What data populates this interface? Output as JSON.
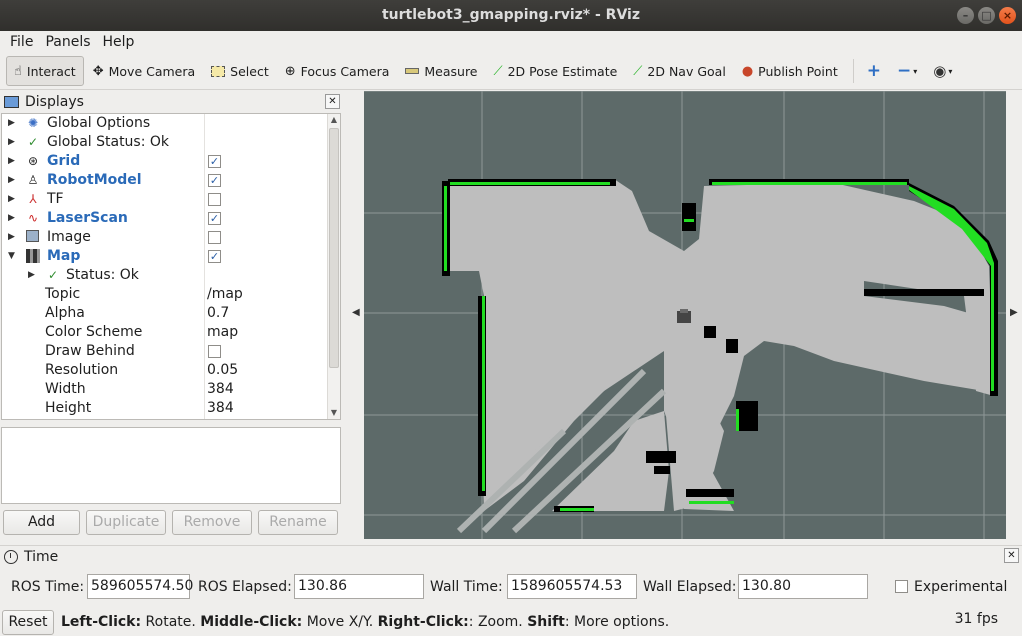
{
  "window": {
    "title": "turtlebot3_gmapping.rviz* - RViz"
  },
  "menu": {
    "file": "File",
    "panels": "Panels",
    "help": "Help"
  },
  "toolbar": {
    "interact": "Interact",
    "move_camera": "Move Camera",
    "select": "Select",
    "focus_camera": "Focus Camera",
    "measure": "Measure",
    "pose_estimate": "2D Pose Estimate",
    "nav_goal": "2D Nav Goal",
    "publish_point": "Publish Point"
  },
  "displays": {
    "title": "Displays",
    "items": [
      {
        "label": "Global Options",
        "icon": "gear-icon"
      },
      {
        "label": "Global Status: Ok",
        "icon": "check-icon"
      },
      {
        "label": "Grid",
        "icon": "grid-icon",
        "checked": true
      },
      {
        "label": "RobotModel",
        "icon": "robot-icon",
        "checked": true
      },
      {
        "label": "TF",
        "icon": "tf-icon",
        "checked": false
      },
      {
        "label": "LaserScan",
        "icon": "laser-icon",
        "checked": true
      },
      {
        "label": "Image",
        "icon": "image-icon",
        "checked": false
      },
      {
        "label": "Map",
        "icon": "map-icon",
        "checked": true
      }
    ],
    "map_props": [
      {
        "label": "Status: Ok"
      },
      {
        "label": "Topic",
        "value": "/map"
      },
      {
        "label": "Alpha",
        "value": "0.7"
      },
      {
        "label": "Color Scheme",
        "value": "map"
      },
      {
        "label": "Draw Behind",
        "checked": false
      },
      {
        "label": "Resolution",
        "value": "0.05"
      },
      {
        "label": "Width",
        "value": "384"
      },
      {
        "label": "Height",
        "value": "384"
      }
    ],
    "buttons": {
      "add": "Add",
      "duplicate": "Duplicate",
      "remove": "Remove",
      "rename": "Rename"
    }
  },
  "time": {
    "title": "Time",
    "ros_time_label": "ROS Time:",
    "ros_time": "589605574.50",
    "ros_elapsed_label": "ROS Elapsed:",
    "ros_elapsed": "130.86",
    "wall_time_label": "Wall Time:",
    "wall_time": "1589605574.53",
    "wall_elapsed_label": "Wall Elapsed:",
    "wall_elapsed": "130.80",
    "experimental": "Experimental"
  },
  "status": {
    "reset": "Reset",
    "left_click": "Left-Click:",
    "left_desc": " Rotate. ",
    "middle_click": "Middle-Click:",
    "middle_desc": " Move X/Y. ",
    "right_click": "Right-Click:",
    "right_desc": ": Zoom. ",
    "shift": "Shift",
    "shift_desc": ": More options.",
    "fps": "31 fps"
  },
  "colors": {
    "map_free": "#bebebe",
    "map_unknown": "#5d6a69",
    "obstacle": "#000000",
    "laser": "#22dd22",
    "grid": "#9aa2a1"
  }
}
